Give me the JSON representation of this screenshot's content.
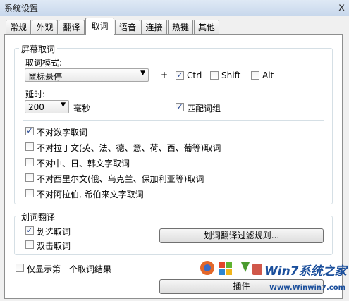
{
  "window": {
    "title": "系统设置",
    "close_glyph": "x"
  },
  "tabs": [
    {
      "label": "常规"
    },
    {
      "label": "外观"
    },
    {
      "label": "翻译"
    },
    {
      "label": "取词",
      "active": true
    },
    {
      "label": "语音"
    },
    {
      "label": "连接"
    },
    {
      "label": "热键"
    },
    {
      "label": "其他"
    }
  ],
  "screen_capture": {
    "group_title": "屏幕取词",
    "mode_label": "取词模式:",
    "mode_value": "鼠标悬停",
    "plus": "+",
    "modifiers": [
      {
        "label": "Ctrl",
        "checked": true
      },
      {
        "label": "Shift",
        "checked": false
      },
      {
        "label": "Alt",
        "checked": false
      }
    ],
    "delay_label": "延时:",
    "delay_value": "200",
    "delay_unit": "毫秒",
    "match_phrase": {
      "label": "匹配词组",
      "checked": true
    },
    "options": [
      {
        "label": "不对数字取词",
        "checked": true
      },
      {
        "label": "不对拉丁文(英、法、德、意、荷、西、葡等)取词",
        "checked": false
      },
      {
        "label": "不对中、日、韩文字取词",
        "checked": false
      },
      {
        "label": "不对西里尔文(俄、乌克兰、保加利亚等)取词",
        "checked": false
      },
      {
        "label": "不对阿拉伯, 希伯来文字取词",
        "checked": false
      }
    ]
  },
  "select_translate": {
    "group_title": "划词翻译",
    "options": [
      {
        "label": "划选取词",
        "checked": true
      },
      {
        "label": "双击取词",
        "checked": false
      }
    ],
    "filter_button": "划词翻译过滤规则..."
  },
  "first_result_only": {
    "label": "仅显示第一个取词结果",
    "checked": false
  },
  "bottom_button": "插件",
  "watermark": {
    "brand": "Win7系统之家",
    "url": "Www.Winwin7.com"
  },
  "colors": {
    "check": "#1c3f8f",
    "titlebar": "#c8d8ec"
  },
  "icons": {
    "checkmark": "✓",
    "dropdown": "▼"
  }
}
